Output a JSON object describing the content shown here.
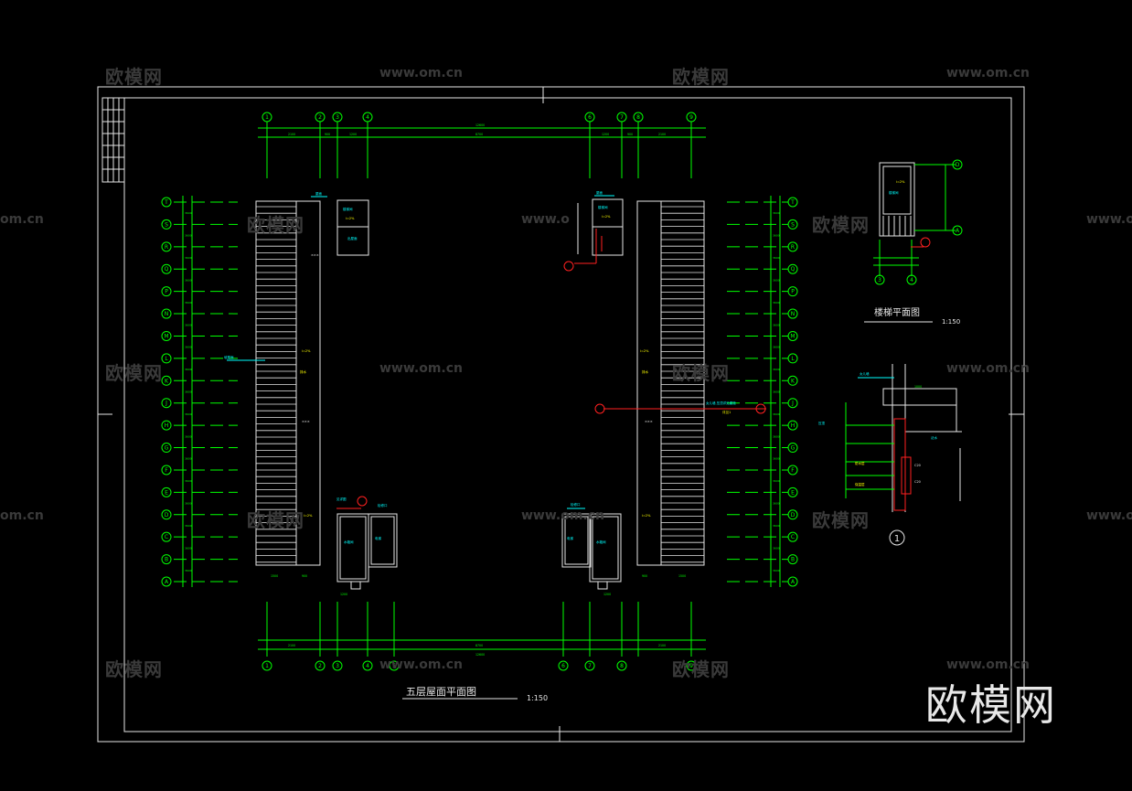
{
  "watermarks": {
    "cn": "欧模网",
    "url": "www.om.cn",
    "url_cut": "om.cn",
    "url_cut2": "www.o"
  },
  "logo": "欧模网",
  "drawing": {
    "main_title": "五层屋面平面图",
    "main_scale": "1:150",
    "stair_title": "楼梯平面图",
    "stair_scale": "1:150",
    "detail_number": "1",
    "top_axes": [
      "1",
      "2",
      "3",
      "4",
      "6",
      "7",
      "8",
      "9"
    ],
    "bottom_axes": [
      "1",
      "2",
      "3",
      "4",
      "5",
      "6",
      "7",
      "8",
      "9"
    ],
    "row_axes": [
      "T",
      "S",
      "R",
      "Q",
      "P",
      "N",
      "M",
      "L",
      "K",
      "J",
      "H",
      "G",
      "F",
      "E",
      "D",
      "C",
      "B",
      "A"
    ],
    "stair_col_axes": [
      "3",
      "4"
    ],
    "stair_row_axes": [
      "D",
      "A"
    ]
  },
  "colors": {
    "background": "#000000",
    "axis": "#00ff00",
    "outline": "#ffffff",
    "text": "#00ffff",
    "callout": "#ff2020",
    "accent": "#ffff00",
    "watermark": "#3a3a3a"
  }
}
